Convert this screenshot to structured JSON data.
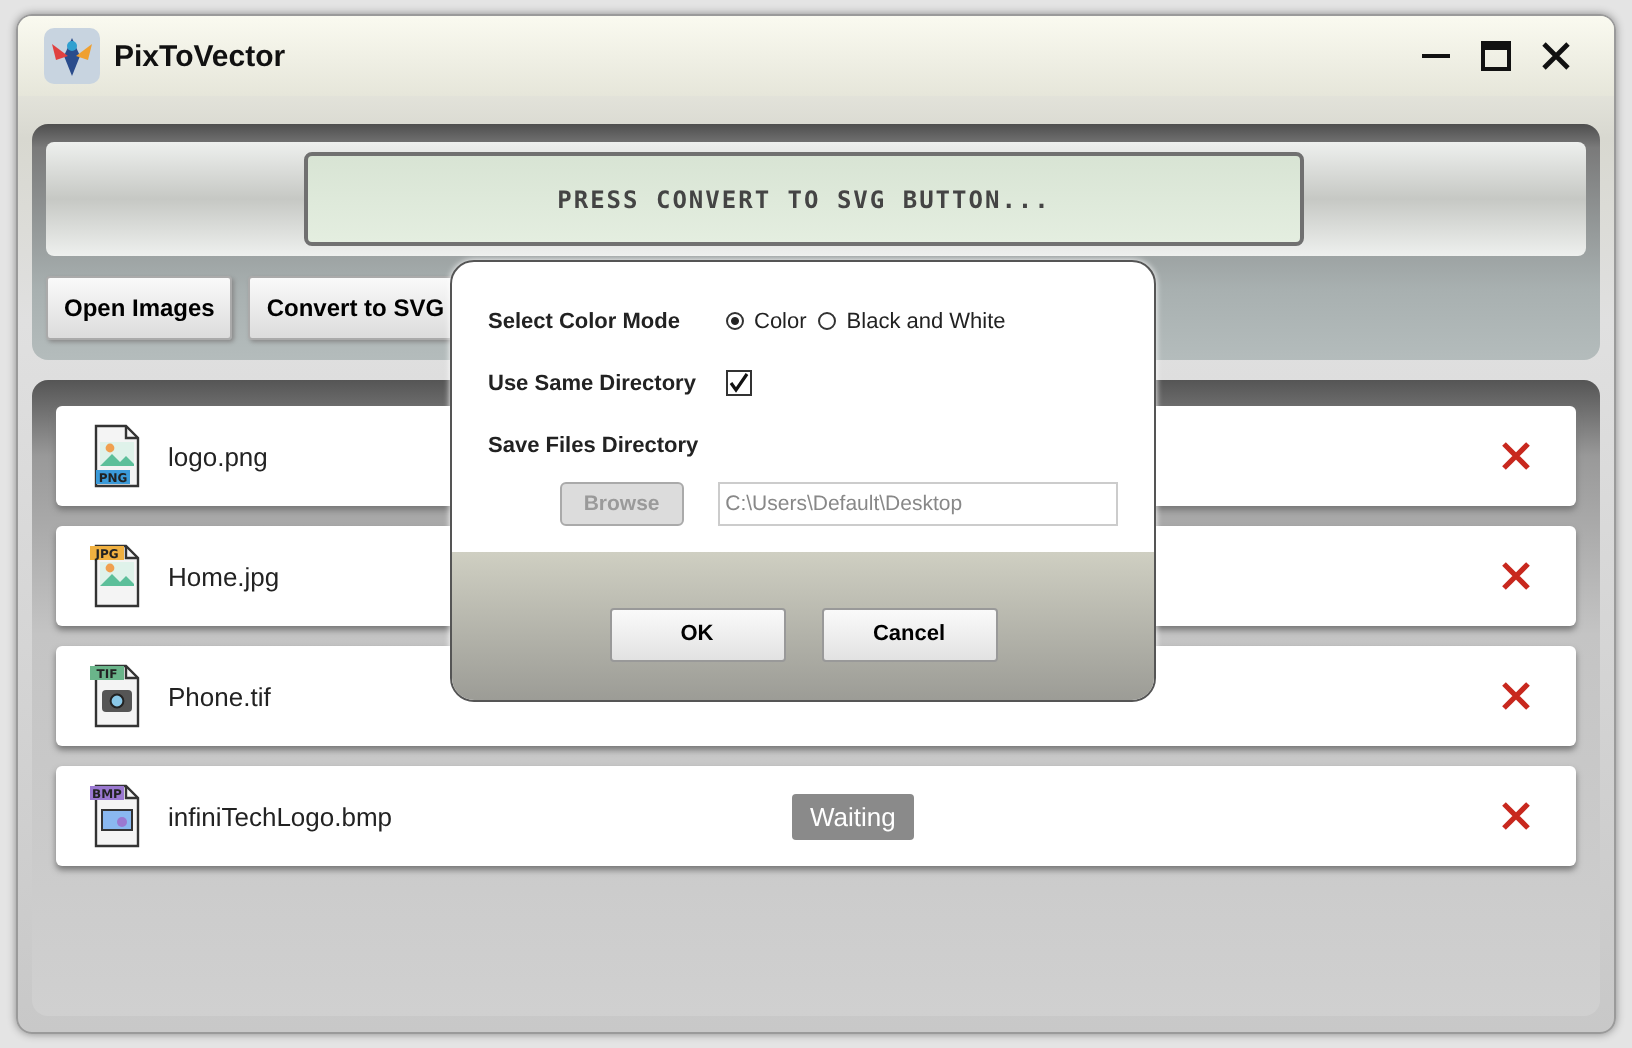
{
  "window": {
    "title": "PixToVector"
  },
  "status_display": {
    "text": "PRESS CONVERT TO SVG BUTTON..."
  },
  "toolbar": {
    "buttons": [
      "Open Images",
      "Convert to SVG"
    ]
  },
  "files": [
    {
      "name": "logo.png",
      "kind": "png",
      "type_label": "PNG",
      "color": "#3a9ad9"
    },
    {
      "name": "Home.jpg",
      "kind": "jpg",
      "type_label": "JPG",
      "color": "#f0b040"
    },
    {
      "name": "Phone.tif",
      "kind": "tif",
      "type_label": "TIF",
      "color": "#6ab58a"
    },
    {
      "name": "infiniTechLogo.bmp",
      "kind": "bmp",
      "type_label": "BMP",
      "color": "#9a78d0",
      "status": "Waiting"
    }
  ],
  "dialog": {
    "color_mode": {
      "label": "Select Color Mode",
      "options": [
        {
          "label": "Color",
          "selected": true
        },
        {
          "label": "Black and White",
          "selected": false
        }
      ]
    },
    "same_directory": {
      "label": "Use Same Directory",
      "checked": true
    },
    "save_directory": {
      "label": "Save Files Directory",
      "browse": {
        "label": "Browse",
        "disabled": true
      },
      "path": "C:\\Users\\Default\\Desktop",
      "disabled": true
    },
    "buttons": [
      "OK",
      "Cancel"
    ]
  }
}
